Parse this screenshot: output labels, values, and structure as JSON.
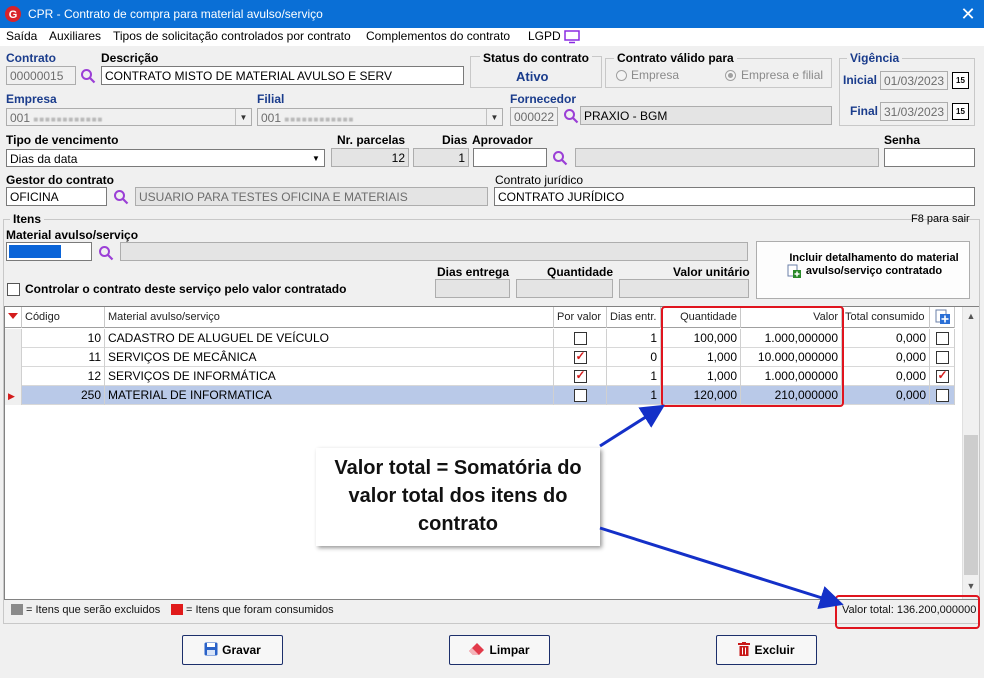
{
  "window": {
    "title": "CPR - Contrato de compra para material avulso/serviço"
  },
  "menu": {
    "items": [
      "Saída",
      "Auxiliares",
      "Tipos de solicitação controlados por contrato",
      "Complementos do contrato",
      "LGPD"
    ]
  },
  "header": {
    "contrato_label": "Contrato",
    "contrato_value": "00000015",
    "descricao_label": "Descrição",
    "descricao_value": "CONTRATO MISTO DE MATERIAL AVULSO E SERV",
    "status_label": "Status do contrato",
    "status_value": "Ativo",
    "valido_label": "Contrato válido para",
    "valido_empresa": "Empresa",
    "valido_empresa_filial": "Empresa e filial",
    "vigencia_label": "Vigência",
    "inicial_label": "Inicial",
    "inicial_value": "01/03/2023",
    "final_label": "Final",
    "final_value": "31/03/2023",
    "empresa_label": "Empresa",
    "empresa_value": "001",
    "filial_label": "Filial",
    "filial_value": "001",
    "fornecedor_label": "Fornecedor",
    "fornecedor_code": "000022",
    "fornecedor_name": "PRAXIO - BGM",
    "tipo_venc_label": "Tipo de vencimento",
    "tipo_venc_value": "Dias da data",
    "nr_parcelas_label": "Nr. parcelas",
    "nr_parcelas_value": "12",
    "dias_label": "Dias",
    "dias_value": "1",
    "aprovador_label": "Aprovador",
    "senha_label": "Senha",
    "gestor_label": "Gestor do contrato",
    "gestor_code": "OFICINA",
    "gestor_name": "USUARIO PARA TESTES OFICINA E MATERIAIS",
    "juridico_label": "Contrato jurídico",
    "juridico_value": "CONTRATO JURÍDICO"
  },
  "itens": {
    "title": "Itens",
    "hint": "F8 para sair",
    "material_label": "Material avulso/serviço",
    "controlar_label": "Controlar o contrato deste serviço pelo valor contratado",
    "dias_entrega_label": "Dias entrega",
    "quantidade_label": "Quantidade",
    "valor_unitario_label": "Valor unitário",
    "incluir_button": "Incluir detalhamento do material avulso/serviço contratado"
  },
  "grid": {
    "columns": [
      "Código",
      "Material avulso/serviço",
      "Por valor",
      "Dias entr.",
      "Quantidade",
      "Valor",
      "Total consumido"
    ],
    "rows": [
      {
        "codigo": "10",
        "material": "CADASTRO DE ALUGUEL DE VEÍCULO",
        "por_valor": false,
        "dias": "1",
        "quantidade": "100,000",
        "valor": "1.000,000000",
        "total": "0,000",
        "consumido": false
      },
      {
        "codigo": "11",
        "material": "SERVIÇOS DE MECÂNICA",
        "por_valor": true,
        "dias": "0",
        "quantidade": "1,000",
        "valor": "10.000,000000",
        "total": "0,000",
        "consumido": false
      },
      {
        "codigo": "12",
        "material": "SERVIÇOS DE INFORMÁTICA",
        "por_valor": true,
        "dias": "1",
        "quantidade": "1,000",
        "valor": "1.000,000000",
        "total": "0,000",
        "consumido": true
      },
      {
        "codigo": "250",
        "material": "MATERIAL DE INFORMATICA",
        "por_valor": false,
        "dias": "1",
        "quantidade": "120,000",
        "valor": "210,000000",
        "total": "0,000",
        "consumido": false
      }
    ]
  },
  "legend": {
    "excluidos": "= Itens que serão excluidos",
    "consumidos": "= Itens que foram consumidos",
    "valor_total": "Valor total: 136.200,000000"
  },
  "callout": {
    "line1": "Valor total = Somatória do",
    "line2": "valor total dos itens do",
    "line3": "contrato"
  },
  "buttons": {
    "gravar": "Gravar",
    "limpar": "Limpar",
    "excluir": "Excluir"
  },
  "colors": {
    "titlebar": "#0a6fd6",
    "label_blue": "#1a3c8c",
    "highlight_red": "#e0141e",
    "arrow_blue": "#1430c8",
    "selected_row": "#b9c9e8"
  }
}
